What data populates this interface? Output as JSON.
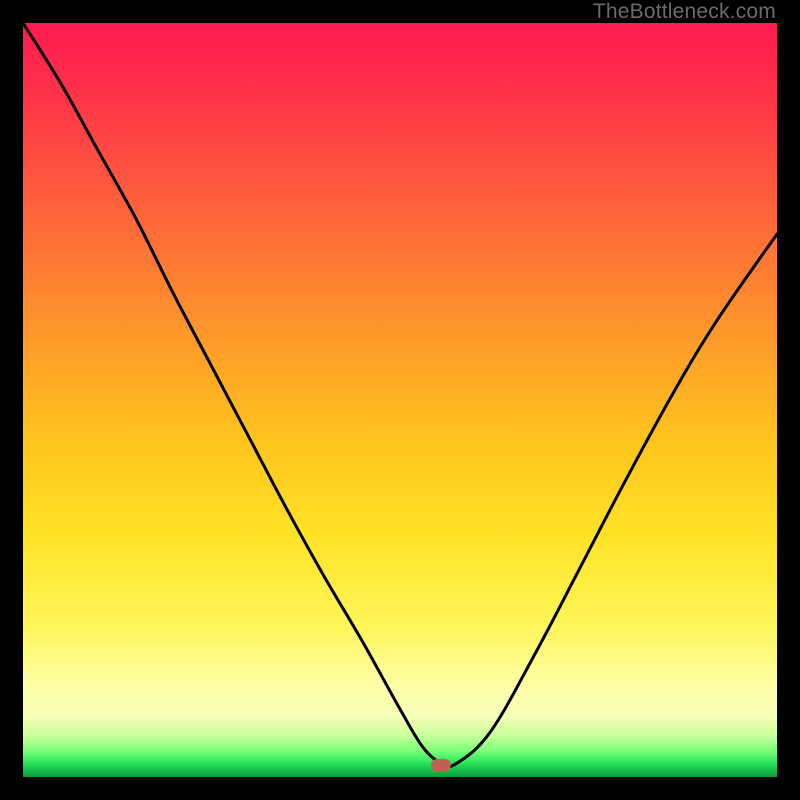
{
  "watermark": "TheBottleneck.com",
  "marker": {
    "x_frac": 0.555,
    "y_frac": 0.984,
    "color": "#c06055"
  },
  "chart_data": {
    "type": "line",
    "title": "",
    "xlabel": "",
    "ylabel": "",
    "xlim": [
      0,
      1
    ],
    "ylim": [
      0,
      1
    ],
    "series": [
      {
        "name": "bottleneck-curve",
        "x": [
          0.0,
          0.05,
          0.1,
          0.15,
          0.2,
          0.25,
          0.3,
          0.35,
          0.4,
          0.45,
          0.5,
          0.53,
          0.555,
          0.575,
          0.62,
          0.68,
          0.74,
          0.8,
          0.86,
          0.92,
          1.0
        ],
        "y": [
          1.0,
          0.92,
          0.83,
          0.74,
          0.64,
          0.545,
          0.45,
          0.355,
          0.265,
          0.18,
          0.09,
          0.04,
          0.018,
          0.018,
          0.06,
          0.165,
          0.28,
          0.395,
          0.505,
          0.605,
          0.72
        ]
      }
    ],
    "annotations": [
      {
        "type": "marker",
        "x": 0.555,
        "y": 0.016,
        "label": "optimal-point"
      }
    ]
  }
}
